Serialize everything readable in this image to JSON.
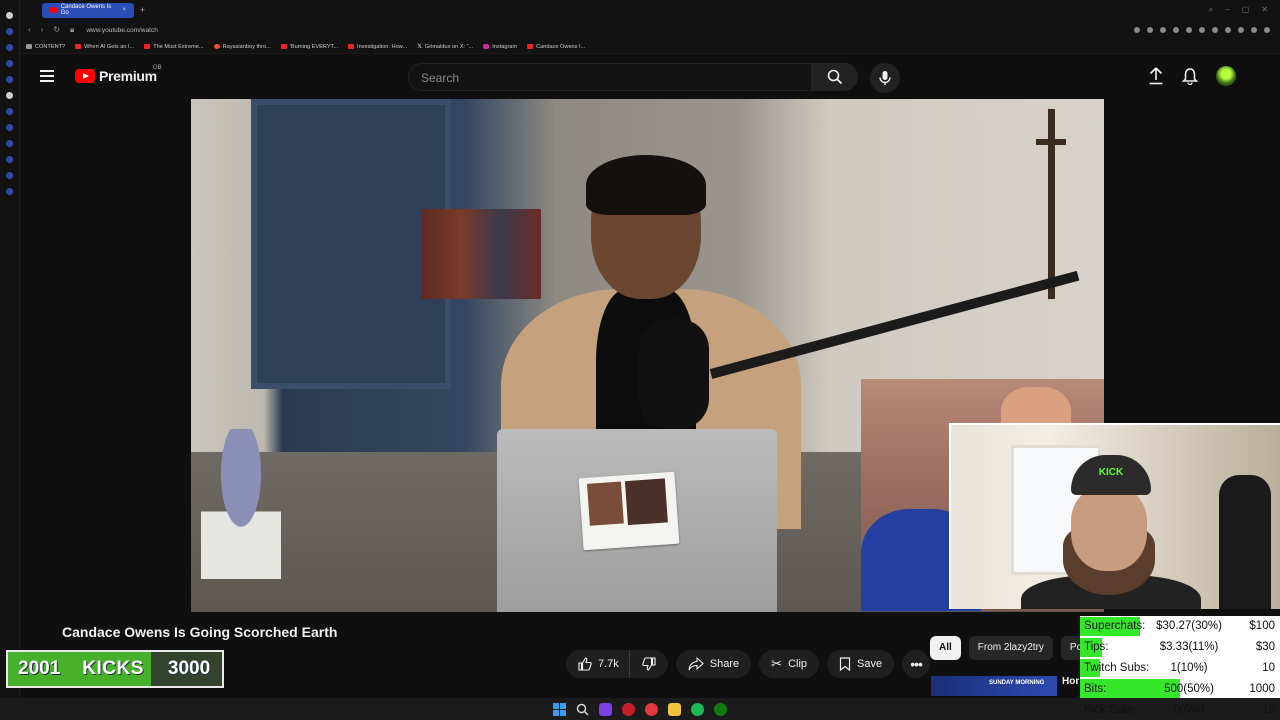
{
  "browser": {
    "tab_title": "Candace Owens Is Go",
    "url": "www.youtube.com/watch",
    "bookmarks": [
      {
        "label": "CONTENT?",
        "icon": "folder-icon"
      },
      {
        "label": "When AI Gets an I...",
        "icon": "youtube-icon"
      },
      {
        "label": "The Most Extreme...",
        "icon": "youtube-icon"
      },
      {
        "label": "Rayasianboy thro...",
        "icon": "site-icon"
      },
      {
        "label": "'Burning EVERYT...",
        "icon": "youtube-icon"
      },
      {
        "label": "Investigation: How...",
        "icon": "youtube-icon"
      },
      {
        "label": "Grimaldus on X: \"...",
        "icon": "x-icon"
      },
      {
        "label": "Instagram",
        "icon": "instagram-icon"
      },
      {
        "label": "Candace Owens I...",
        "icon": "youtube-icon"
      }
    ]
  },
  "header": {
    "logo_text": "Premium",
    "region": "GB",
    "search_placeholder": "Search"
  },
  "video": {
    "title": "Candace Owens Is Going Scorched Earth",
    "likes": "7.7k",
    "share_label": "Share",
    "clip_label": "Clip",
    "save_label": "Save"
  },
  "sidebar_chips": [
    "All",
    "From 2lazy2try",
    "Po"
  ],
  "related": {
    "thumb_text": "SUNDAY MORNING",
    "title_fragment": "Hor"
  },
  "kicks": {
    "current": "2001",
    "label": "KICKS",
    "goal": "3000",
    "progress": 0.667
  },
  "stats": [
    {
      "label": "Superchats:",
      "value": "$30.27(30%)",
      "goal": "$100",
      "progress": 0.3
    },
    {
      "label": "Tips:",
      "value": "$3.33(11%)",
      "goal": "$30",
      "progress": 0.11
    },
    {
      "label": "Twitch Subs:",
      "value": "1(10%)",
      "goal": "10",
      "progress": 0.1
    },
    {
      "label": "Bits:",
      "value": "500(50%)",
      "goal": "1000",
      "progress": 0.5
    },
    {
      "label": "Kick Subs:",
      "value": "0(0%)",
      "goal": "10",
      "progress": 0.0
    }
  ],
  "colors": {
    "youtube_red": "#ff0000",
    "progress_green": "#35e62a",
    "kicks_green": "#5fc53c",
    "background": "#0f0f0f"
  }
}
